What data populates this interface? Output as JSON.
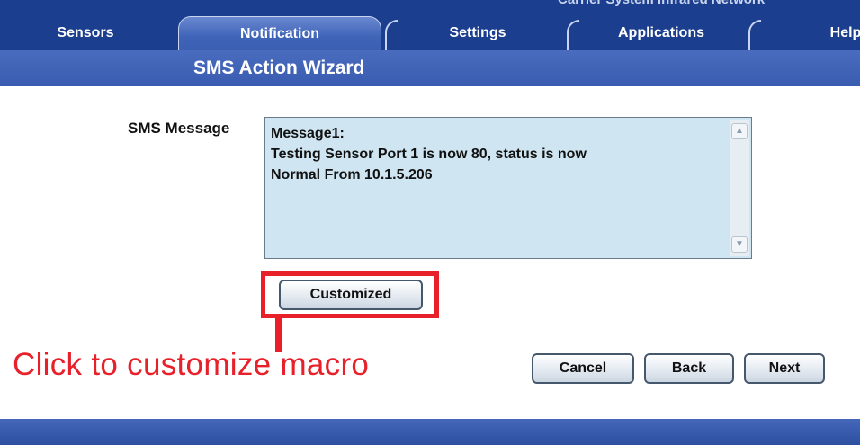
{
  "app": {
    "header_text": "Carrier System Infrared Network"
  },
  "tabs": [
    {
      "label": "Sensors",
      "active": false
    },
    {
      "label": "Notification",
      "active": true
    },
    {
      "label": "Settings",
      "active": false
    },
    {
      "label": "Applications",
      "active": false
    },
    {
      "label": "Help",
      "active": false
    }
  ],
  "wizard": {
    "title": "SMS Action Wizard",
    "sms_label": "SMS Message",
    "sms_lines": [
      "Message1:",
      "Testing Sensor Port 1 is now 80, status is now",
      "Normal From 10.1.5.206"
    ],
    "customized_label": "Customized"
  },
  "actions": {
    "cancel_label": "Cancel",
    "back_label": "Back",
    "next_label": "Next"
  },
  "annotation": {
    "text": "Click to customize macro",
    "color": "#e8202a"
  },
  "colors": {
    "tab_bar": "#1b3e8e",
    "title_bar": "#3a5cb0",
    "message_bg": "#cfe6f2"
  }
}
